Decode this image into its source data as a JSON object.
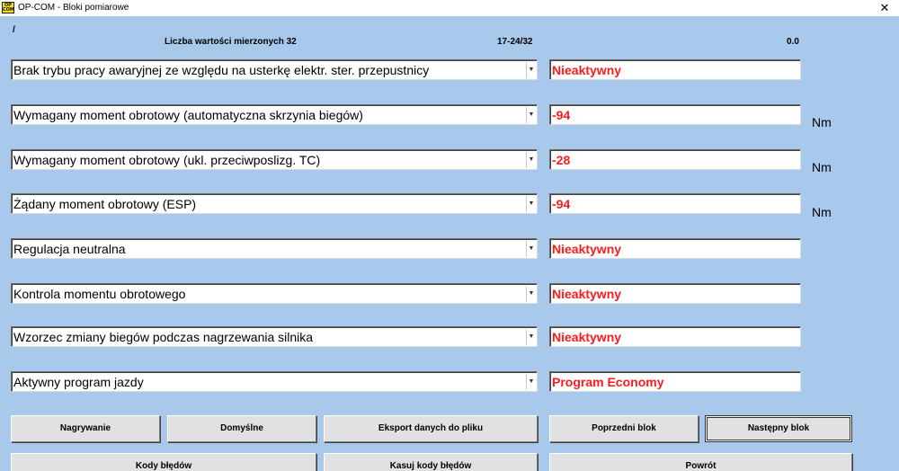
{
  "window": {
    "title": "OP-COM - Bloki pomiarowe",
    "close_label": "✕",
    "icon_text": "OP COM"
  },
  "info": {
    "slash": "/",
    "count_label": "Liczba wartości mierzonych 32",
    "range": "17-24/32",
    "time": "0.0"
  },
  "rows": [
    {
      "label": "Brak trybu pracy awaryjnej ze względu na usterkę elektr. ster. przepustnicy",
      "value": "Nieaktywny",
      "unit": ""
    },
    {
      "label": "Wymagany moment obrotowy (automatyczna skrzynia biegów)",
      "value": "-94",
      "unit": "Nm"
    },
    {
      "label": "Wymagany moment obrotowy (ukl. przeciwposlizg. TC)",
      "value": "-28",
      "unit": "Nm"
    },
    {
      "label": "Żądany moment obrotowy (ESP)",
      "value": "-94",
      "unit": "Nm"
    },
    {
      "label": "Regulacja neutralna",
      "value": "Nieaktywny",
      "unit": ""
    },
    {
      "label": "Kontrola momentu obrotowego",
      "value": "Nieaktywny",
      "unit": ""
    },
    {
      "label": "Wzorzec zmiany biegów podczas nagrzewania silnika",
      "value": "Nieaktywny",
      "unit": ""
    },
    {
      "label": "Aktywny program jazdy",
      "value": "Program Economy",
      "unit": ""
    }
  ],
  "dropdown_arrow": "▼",
  "buttons": {
    "record": "Nagrywanie",
    "defaults": "Domyślne",
    "export": "Eksport danych do pliku",
    "prev_block": "Poprzedni blok",
    "next_block": "Następny blok",
    "error_codes": "Kody błędów",
    "clear_codes": "Kasuj kody błędów",
    "back": "Powrót"
  },
  "colors": {
    "background": "#a8c8ec",
    "value_text": "#ff1a1a",
    "button_face": "#e1e1e1"
  }
}
